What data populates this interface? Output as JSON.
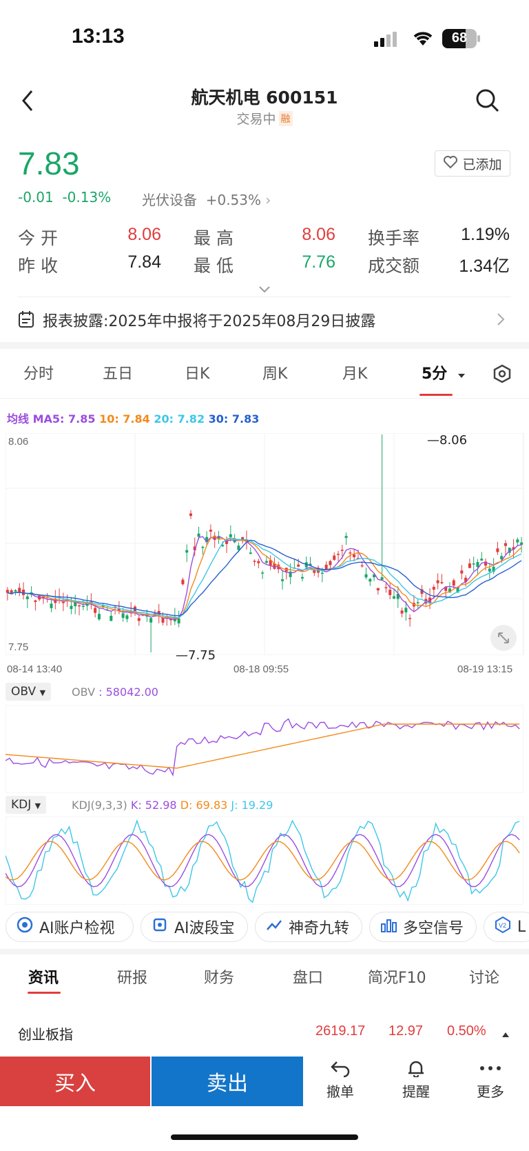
{
  "status": {
    "time": "13:13",
    "battery": "68"
  },
  "header": {
    "title": "航天机电  600151",
    "subtitle": "交易中",
    "badge": "融"
  },
  "quote": {
    "price": "7.83",
    "change": "-0.01",
    "change_pct": "-0.13%",
    "sector": "光伏设备",
    "sector_change": "+0.53%",
    "fav_label": "已添加",
    "stats": [
      {
        "label": "今 开",
        "value": "8.06",
        "tone": "red"
      },
      {
        "label": "最 高",
        "value": "8.06",
        "tone": "red"
      },
      {
        "label": "换手率",
        "value": "1.19%",
        "tone": "dark"
      },
      {
        "label": "昨 收",
        "value": "7.84",
        "tone": "dark"
      },
      {
        "label": "最 低",
        "value": "7.76",
        "tone": "green"
      },
      {
        "label": "成交额",
        "value": "1.34亿",
        "tone": "dark"
      }
    ]
  },
  "notice": "报表披露:2025年中报将于2025年08月29日披露",
  "chart_tabs": [
    "分时",
    "五日",
    "日K",
    "周K",
    "月K",
    "5分"
  ],
  "chart_tab_active": "5分",
  "ma_legend": {
    "title": "均线",
    "items": [
      {
        "text": "MA5: 7.85",
        "color": "#9b4de0"
      },
      {
        "text": "10: 7.84",
        "color": "#f28a1a"
      },
      {
        "text": "20: 7.82",
        "color": "#3ec6e8"
      },
      {
        "text": "30: 7.83",
        "color": "#2560d0"
      }
    ]
  },
  "chart_data": {
    "type": "candlestick",
    "price_axis": {
      "top": "8.06",
      "bottom": "7.75"
    },
    "high_marker": "8.06",
    "low_marker": "7.75",
    "x_labels": [
      "08-14 13:40",
      "08-18 09:55",
      "08-19 13:15"
    ],
    "obv": {
      "selector": "OBV",
      "label": "OBV",
      "value": ": 58042.00",
      "color": "#9b4de0"
    },
    "kdj": {
      "selector": "KDJ",
      "params": "KDJ(9,3,3)",
      "k": "K: 52.98",
      "d": "D: 69.83",
      "j": "J: 19.29",
      "colors": {
        "k": "#9b4de0",
        "d": "#f28a1a",
        "j": "#3ec6e8"
      }
    }
  },
  "tools": [
    "AI账户检视",
    "AI波段宝",
    "神奇九转",
    "多空信号",
    "L"
  ],
  "info_tabs": [
    "资讯",
    "研报",
    "财务",
    "盘口",
    "简况F10",
    "讨论"
  ],
  "index_row": {
    "name": "创业板指",
    "value": "2619.17",
    "change": "12.97",
    "pct": "0.50%"
  },
  "actions": {
    "buy": "买入",
    "sell": "卖出",
    "cancel": "撤单",
    "alert": "提醒",
    "more": "更多"
  }
}
